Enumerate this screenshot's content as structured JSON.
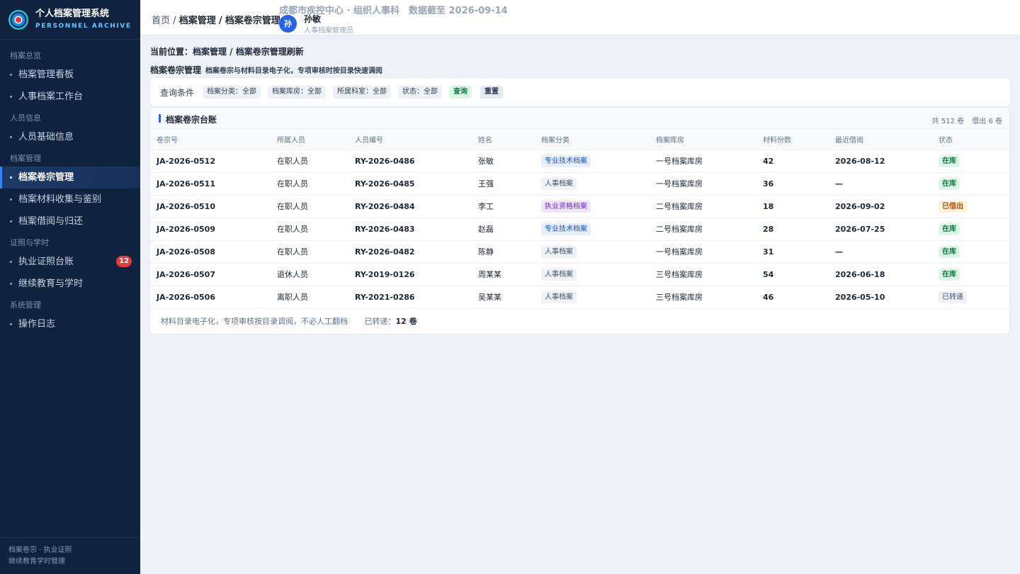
{
  "app": {
    "title": "个人档案管理系统",
    "subtitle": "PERSONNEL ARCHIVE"
  },
  "nav": [
    {
      "group": "档案总览",
      "items": [
        {
          "label": "档案管理看板"
        },
        {
          "label": "人事档案工作台"
        }
      ]
    },
    {
      "group": "人员信息",
      "items": [
        {
          "label": "人员基础信息"
        }
      ]
    },
    {
      "group": "档案管理",
      "items": [
        {
          "label": "档案卷宗管理",
          "active": true
        },
        {
          "label": "档案材料收集与鉴别"
        },
        {
          "label": "档案借阅与归还"
        }
      ]
    },
    {
      "group": "证照与学时",
      "items": [
        {
          "label": "执业证照台账",
          "badge": "12"
        },
        {
          "label": "继续教育与学时"
        }
      ]
    },
    {
      "group": "系统管理",
      "items": [
        {
          "label": "操作日志"
        }
      ]
    }
  ],
  "sidebar_footer": {
    "line1": "档案卷宗 · 执业证照",
    "line2": "继续教育学时管理"
  },
  "header": {
    "crumb_home": "首页",
    "crumb_sep": "/",
    "crumb_1": "档案管理",
    "crumb_2": "档案卷宗管理",
    "org": "成都市疾控中心 · 组织人事科　数据截至 2026-09-14",
    "user_initial": "孙",
    "user_name": "孙敏",
    "user_role": "人事档案管理员"
  },
  "location": "当前位置：档案管理 / 档案卷宗管理刷新",
  "page": {
    "title": "档案卷宗管理",
    "subtitle": "档案卷宗与材料目录电子化，专项审核时按目录快速调阅"
  },
  "filter": {
    "label": "查询条件",
    "chips": [
      "档案分类：全部",
      "档案库房：全部",
      "所属科室：全部",
      "状态：全部"
    ],
    "query_label": "查询",
    "reset_label": "重置"
  },
  "panel": {
    "title": "档案卷宗台账",
    "total": "共 512 卷",
    "borrowed": "借出 6 卷"
  },
  "table": {
    "columns": [
      "卷宗号",
      "所属人员",
      "人员编号",
      "姓名",
      "档案分类",
      "档案库房",
      "材料份数",
      "最近借阅",
      "状态"
    ],
    "rows": [
      {
        "id": "JA-2026-0512",
        "person_type": "在职人员",
        "person_no": "RY-2026-0486",
        "name": "张敏",
        "category": "专业技术档案",
        "cat_color": "blue",
        "room": "一号档案库房",
        "count": "42",
        "last_borrow": "2026-08-12",
        "status": "在库",
        "st_color": "green"
      },
      {
        "id": "JA-2026-0511",
        "person_type": "在职人员",
        "person_no": "RY-2026-0485",
        "name": "王强",
        "category": "人事档案",
        "cat_color": "gray",
        "room": "一号档案库房",
        "count": "36",
        "last_borrow": "—",
        "status": "在库",
        "st_color": "green"
      },
      {
        "id": "JA-2026-0510",
        "person_type": "在职人员",
        "person_no": "RY-2026-0484",
        "name": "李工",
        "category": "执业资格档案",
        "cat_color": "purple",
        "room": "二号档案库房",
        "count": "18",
        "last_borrow": "2026-09-02",
        "status": "已借出",
        "st_color": "orange"
      },
      {
        "id": "JA-2026-0509",
        "person_type": "在职人员",
        "person_no": "RY-2026-0483",
        "name": "赵磊",
        "category": "专业技术档案",
        "cat_color": "blue",
        "room": "二号档案库房",
        "count": "28",
        "last_borrow": "2026-07-25",
        "status": "在库",
        "st_color": "green"
      },
      {
        "id": "JA-2026-0508",
        "person_type": "在职人员",
        "person_no": "RY-2026-0482",
        "name": "陈静",
        "category": "人事档案",
        "cat_color": "gray",
        "room": "一号档案库房",
        "count": "31",
        "last_borrow": "—",
        "status": "在库",
        "st_color": "green"
      },
      {
        "id": "JA-2026-0507",
        "person_type": "退休人员",
        "person_no": "RY-2019-0126",
        "name": "周某某",
        "category": "人事档案",
        "cat_color": "gray",
        "room": "三号档案库房",
        "count": "54",
        "last_borrow": "2026-06-18",
        "status": "在库",
        "st_color": "green"
      },
      {
        "id": "JA-2026-0506",
        "person_type": "离职人员",
        "person_no": "RY-2021-0286",
        "name": "吴某某",
        "category": "人事档案",
        "cat_color": "gray",
        "room": "三号档案库房",
        "count": "46",
        "last_borrow": "2026-05-10",
        "status": "已转递",
        "st_color": "gray"
      }
    ]
  },
  "footer": {
    "note": "材料目录电子化，专项审核按目录调阅，不必人工翻档",
    "transferred_label": "已转递：",
    "transferred_value": "12 卷"
  },
  "colors": {
    "sidebar_bg": "#0f2240",
    "accent": "#2563eb",
    "status_green": "#16794a",
    "status_orange": "#b45309"
  }
}
